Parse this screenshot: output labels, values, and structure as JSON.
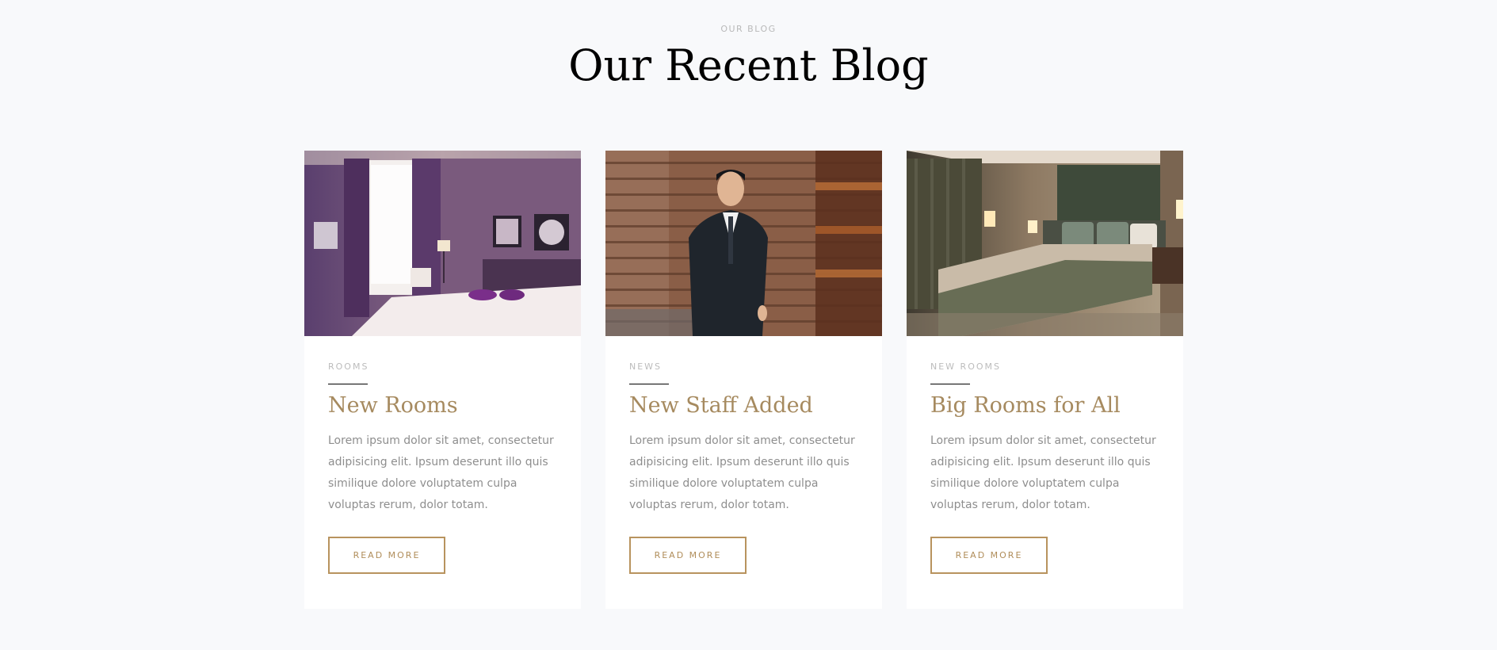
{
  "header": {
    "eyebrow": "OUR BLOG",
    "title": "Our Recent Blog"
  },
  "posts": [
    {
      "category": "ROOMS",
      "title": "New Rooms",
      "excerpt": "Lorem ipsum dolor sit amet, consectetur adipisicing elit. Ipsum deserunt illo quis similique dolore voluptatem culpa voluptas rerum, dolor totam.",
      "button": "READ MORE",
      "image": "hotel-room-purple-photo"
    },
    {
      "category": "NEWS",
      "title": "New Staff Added",
      "excerpt": "Lorem ipsum dolor sit amet, consectetur adipisicing elit. Ipsum deserunt illo quis similique dolore voluptatem culpa voluptas rerum, dolor totam.",
      "button": "READ MORE",
      "image": "staff-man-in-suit-photo"
    },
    {
      "category": "NEW ROOMS",
      "title": "Big Rooms for All",
      "excerpt": "Lorem ipsum dolor sit amet, consectetur adipisicing elit. Ipsum deserunt illo quis similique dolore voluptatem culpa voluptas rerum, dolor totam.",
      "button": "READ MORE",
      "image": "hotel-room-bed-photo"
    }
  ],
  "colors": {
    "accent": "#b08d5a",
    "background": "#f8f9fb",
    "card": "#ffffff"
  }
}
